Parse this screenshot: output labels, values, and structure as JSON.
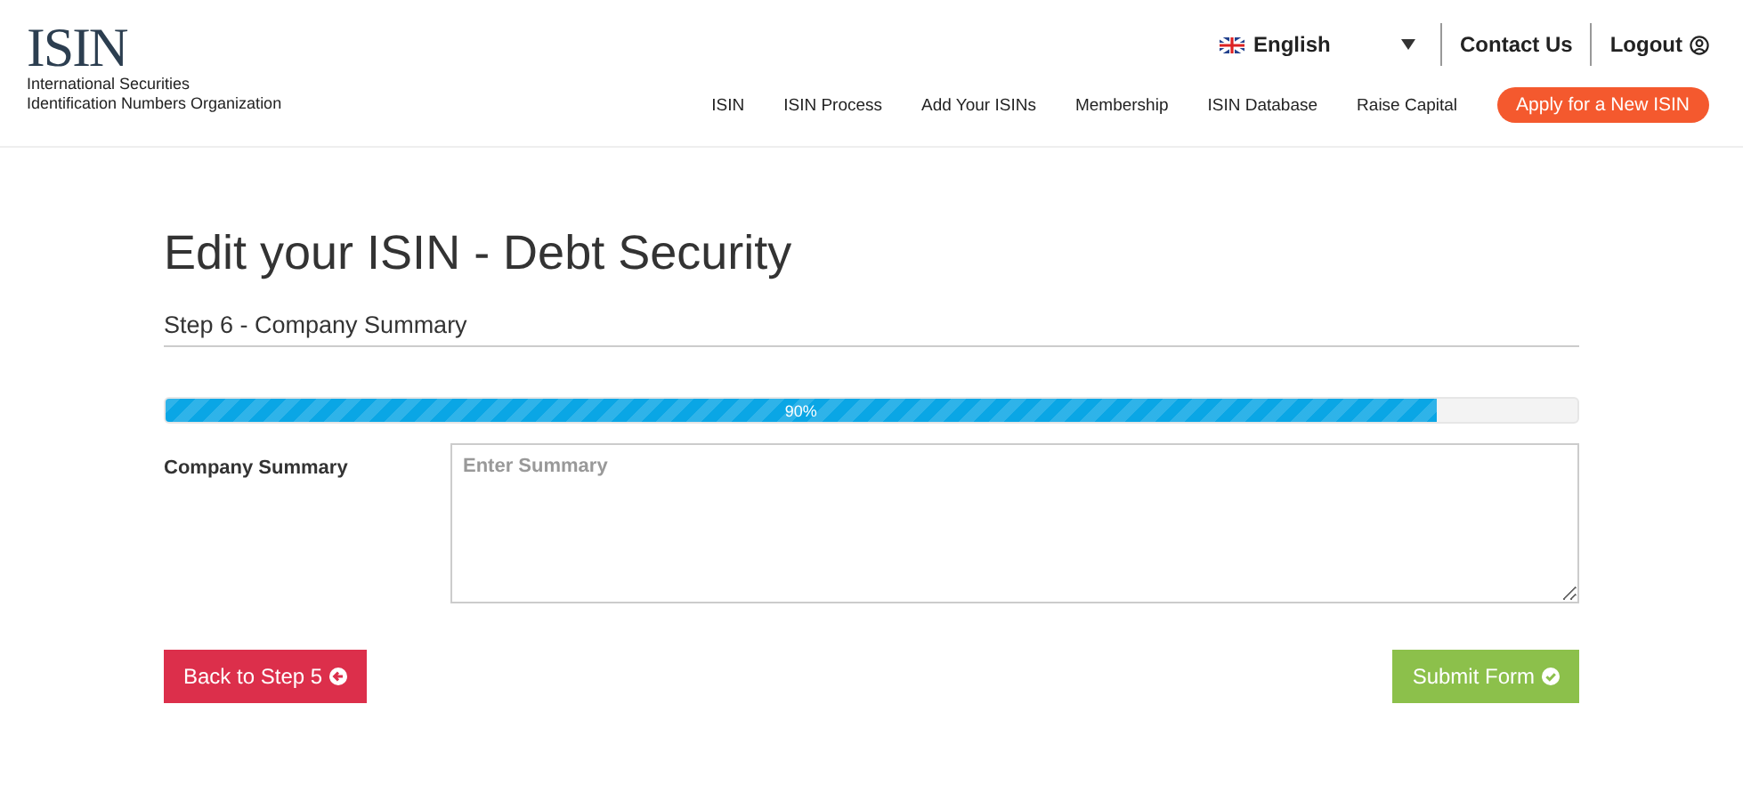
{
  "header": {
    "logo": "ISIN",
    "org_lines": [
      "International Securities",
      "Identification Numbers Organization"
    ],
    "language": "English",
    "contact": "Contact Us",
    "logout": "Logout",
    "nav": [
      "ISIN",
      "ISIN Process",
      "Add Your ISINs",
      "Membership",
      "ISIN Database",
      "Raise Capital"
    ],
    "cta": "Apply for a New ISIN"
  },
  "page": {
    "title": "Edit your ISIN - Debt Security",
    "step": "Step 6 - Company Summary",
    "progress": {
      "level": 0.9,
      "reading": "90%"
    },
    "field": {
      "label": "Company Summary",
      "placeholder": "Enter Summary"
    },
    "back_button": "Back to Step 5",
    "submit_button": "Submit Form"
  }
}
